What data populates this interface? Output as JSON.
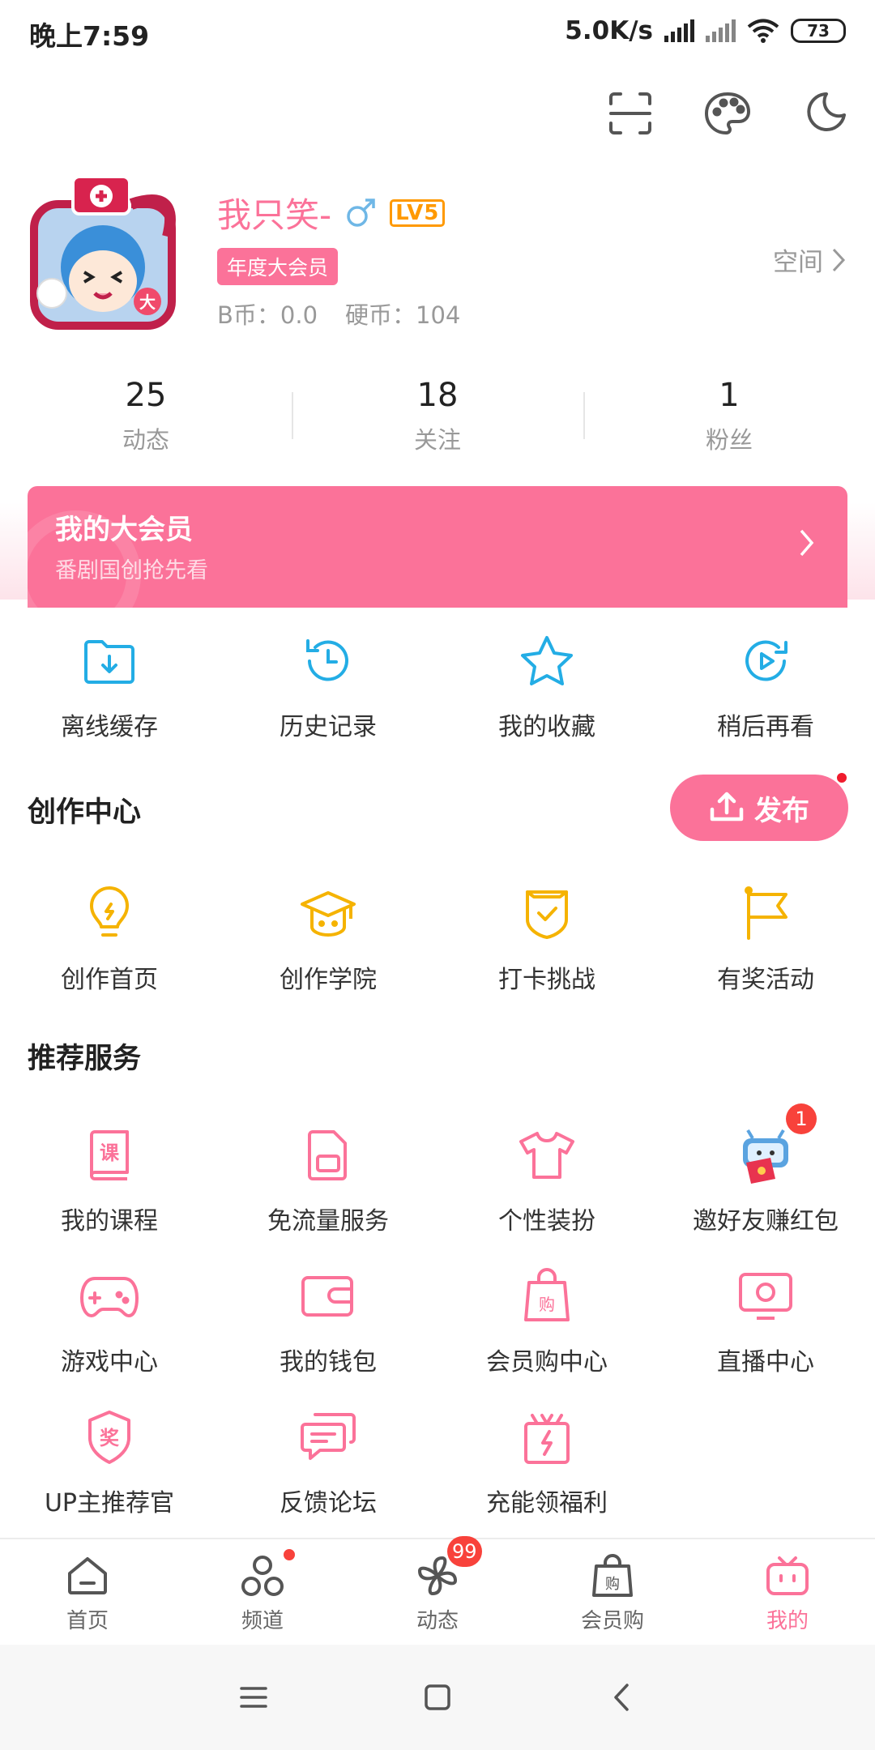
{
  "status_bar": {
    "time": "晚上7:59",
    "net_speed": "5.0K/s",
    "battery": "73"
  },
  "profile": {
    "username": "我只笑-",
    "level": "LV5",
    "vip_tag": "年度大会员",
    "b_coins": "B币：0.0",
    "coins": "硬币：104",
    "space_link": "空间"
  },
  "stats": [
    {
      "value": "25",
      "label": "动态"
    },
    {
      "value": "18",
      "label": "关注"
    },
    {
      "value": "1",
      "label": "粉丝"
    }
  ],
  "vip_banner": {
    "title": "我的大会员",
    "subtitle": "番剧国创抢先看"
  },
  "quick_items": [
    {
      "label": "离线缓存",
      "icon": "offline-cache-icon"
    },
    {
      "label": "历史记录",
      "icon": "history-icon"
    },
    {
      "label": "我的收藏",
      "icon": "star-icon"
    },
    {
      "label": "稍后再看",
      "icon": "watch-later-icon"
    }
  ],
  "creation": {
    "title": "创作中心",
    "publish_label": "发布",
    "items": [
      {
        "label": "创作首页",
        "icon": "lightbulb-icon"
      },
      {
        "label": "创作学院",
        "icon": "graduation-cap-icon"
      },
      {
        "label": "打卡挑战",
        "icon": "checkin-shield-icon"
      },
      {
        "label": "有奖活动",
        "icon": "flag-icon"
      }
    ]
  },
  "services": {
    "title": "推荐服务",
    "items": [
      {
        "label": "我的课程",
        "icon": "course-book-icon"
      },
      {
        "label": "免流量服务",
        "icon": "sim-card-icon"
      },
      {
        "label": "个性装扮",
        "icon": "tshirt-icon"
      },
      {
        "label": "邀好友赚红包",
        "icon": "invite-redpacket-icon",
        "badge": "1"
      },
      {
        "label": "游戏中心",
        "icon": "gamepad-icon"
      },
      {
        "label": "我的钱包",
        "icon": "wallet-icon"
      },
      {
        "label": "会员购中心",
        "icon": "shopping-bag-icon"
      },
      {
        "label": "直播中心",
        "icon": "live-tv-icon"
      },
      {
        "label": "UP主推荐官",
        "icon": "award-badge-icon"
      },
      {
        "label": "反馈论坛",
        "icon": "chat-bubbles-icon"
      },
      {
        "label": "充能领福利",
        "icon": "gift-box-icon"
      }
    ]
  },
  "bottom_nav": [
    {
      "label": "首页",
      "icon": "home-icon"
    },
    {
      "label": "频道",
      "icon": "channel-icon"
    },
    {
      "label": "动态",
      "icon": "pinwheel-icon",
      "badge": "99"
    },
    {
      "label": "会员购",
      "icon": "shopping-bag-icon"
    },
    {
      "label": "我的",
      "icon": "tv-mine-icon",
      "active": true
    }
  ],
  "colors": {
    "accent": "#FB7299",
    "blue": "#23ADE5",
    "yellow": "#F5B301",
    "text": "#333333"
  }
}
